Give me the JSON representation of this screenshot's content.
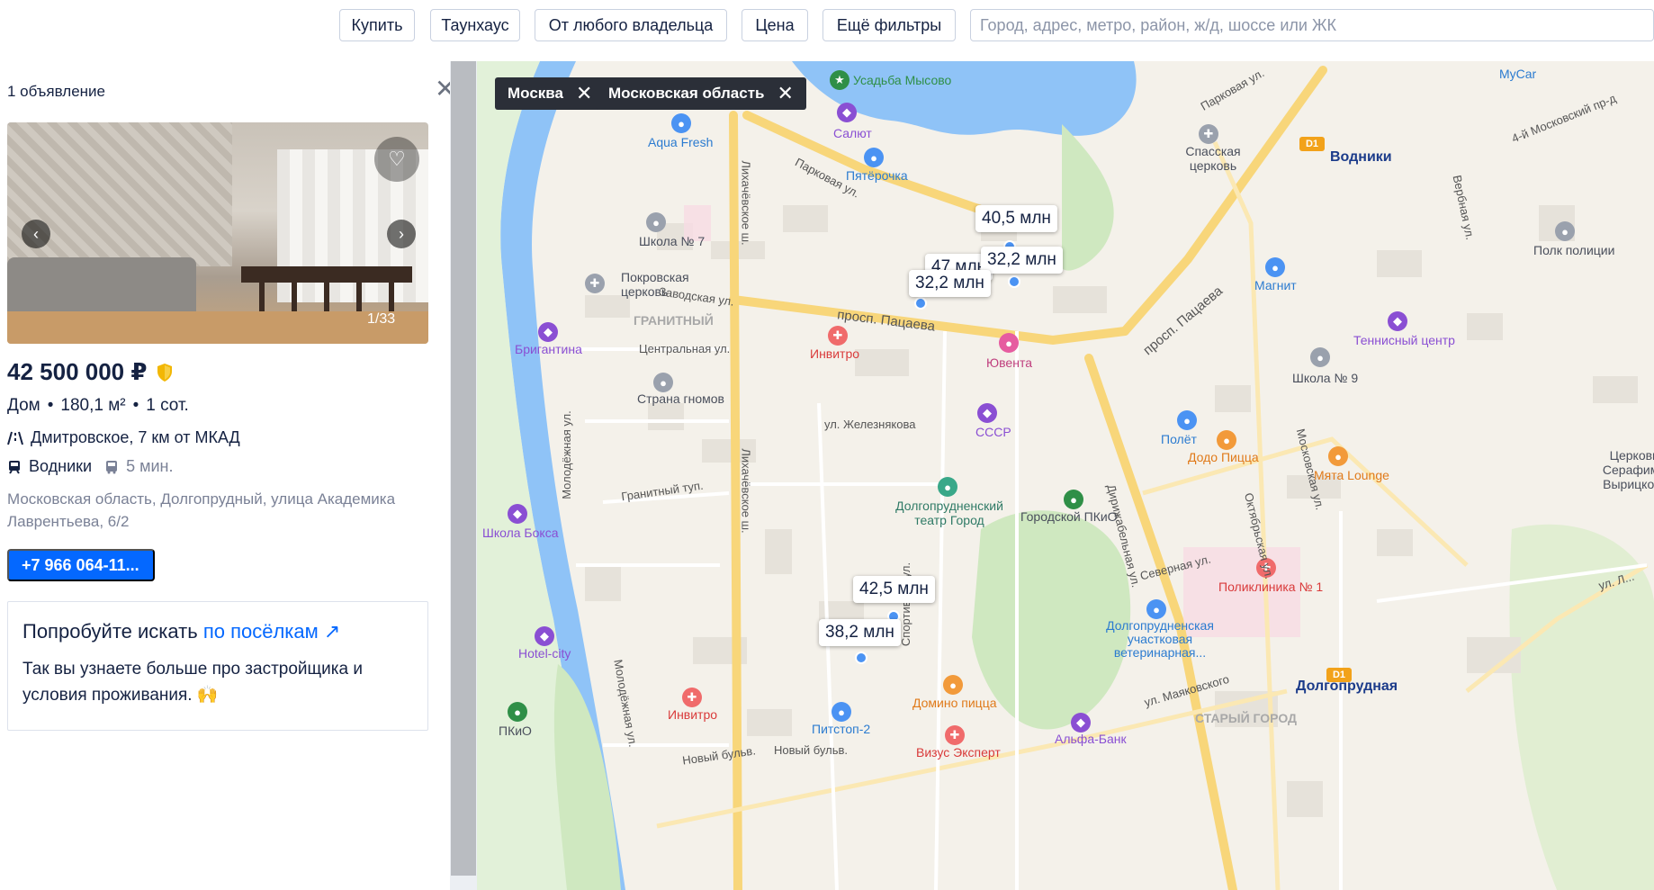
{
  "filters": {
    "buy": "Купить",
    "townhouse": "Таунхаус",
    "owner": "От любого владельца",
    "price": "Цена",
    "more": "Ещё фильтры",
    "search_placeholder": "Город, адрес, метро, район, ж/д, шоссе или ЖК"
  },
  "listing": {
    "count": "1 объявление",
    "photo_counter": "1/33",
    "price": "42 500 000 ₽",
    "type": "Дом",
    "area": "180,1 м²",
    "land": "1 сот.",
    "highway": "Дмитровское, 7 км от МКАД",
    "station": "Водники",
    "walk": "5 мин.",
    "address": "Московская область, Долгопрудный, улица Академика Лаврентьева, 6/2",
    "phone": "+7 966 064-11...",
    "icons": [
      "heart-icon",
      "chevron-left-icon",
      "chevron-right-icon",
      "shield-icon",
      "road-icon",
      "train-icon",
      "bus-icon"
    ]
  },
  "promo": {
    "title_prefix": "Попробуйте искать ",
    "title_link": "по посёлкам",
    "text": "Так вы узнаете больше про застройщика и условия проживания. 🙌"
  },
  "map": {
    "chips": [
      "Москва",
      "Московская область"
    ],
    "markers": [
      "40,5 млн",
      "47 млн",
      "32,2 млн",
      "32,2 млн",
      "42,5 млн",
      "38,2 млн"
    ],
    "places": {
      "usadba": "Усадьба Мысово",
      "mycar": "MyCar",
      "aqua": "Aqua Fresh",
      "salut": "Салют",
      "pyaterochka": "Пятёрочка",
      "spasskaya": "Спасская церковь",
      "vodniki": "Водники",
      "school7": "Школа № 7",
      "pokrovskaya": "Покровская церковь",
      "granitny": "ГРАНИТНЫЙ",
      "brigantina": "Бригантина",
      "strana": "Страна гномов",
      "invitro1": "Инвитро",
      "yuventa": "Ювента",
      "magnit": "Магнит",
      "tennis": "Теннисный центр",
      "police": "Полк полиции",
      "school9": "Школа № 9",
      "sssr": "СССР",
      "polet": "Полёт",
      "dodo": "Додо Пицца",
      "myata": "Мята Lounge",
      "serafim": "Церковь Серафима Вырицкого",
      "theatre": "Долгопрудненский театр Город",
      "pkio": "Городской ПКиО",
      "boxing": "Школа Бокса",
      "hotel": "Hotel-city",
      "pkio2": "ПКиО",
      "invitro2": "Инвитро",
      "pitstop": "Питстоп-2",
      "domino": "Домино пицца",
      "vizus": "Визус Эксперт",
      "poliklinika": "Поликлиника № 1",
      "vet": "Долгопрудненская участковая ветеринарная...",
      "dolgoprudnaya": "Долгопрудная",
      "starygorod": "СТАРЫЙ ГОРОД",
      "alfa": "Альфа-Банк"
    },
    "streets": {
      "parkovaya": "Парковая ул.",
      "parkovaya2": "Парковая ул.",
      "moskovsky4": "4-й Московский пр-д",
      "verbnaya": "Вербная ул.",
      "likhachevskoe1": "Лихачёвское ш.",
      "likhachevskoe2": "Лихачёвское ш.",
      "zavodskaya": "Заводская ул.",
      "patsaeva1": "просп. Пацаева",
      "patsaeva2": "просп. Пацаева",
      "centralnaya": "Центральная ул.",
      "zheleznyakova": "ул. Железнякова",
      "molodezhnaya1": "Молодёжная ул.",
      "granitny_tup": "Гранитный туп.",
      "sportivnaya": "Спортивная ул.",
      "dirizhablnaya": "Дирижабельная ул.",
      "oktyabrskaya": "Октябрьская ул.",
      "severnaya": "Северная ул.",
      "moskovskaya": "Московская ул.",
      "mayakovskogo": "ул. Маяковского",
      "novy1": "Новый бульв.",
      "novy2": "Новый бульв.",
      "molodezhnaya2": "Молодёжная ул.",
      "ul": "ул. Л..."
    },
    "metro_badge": "D1"
  }
}
